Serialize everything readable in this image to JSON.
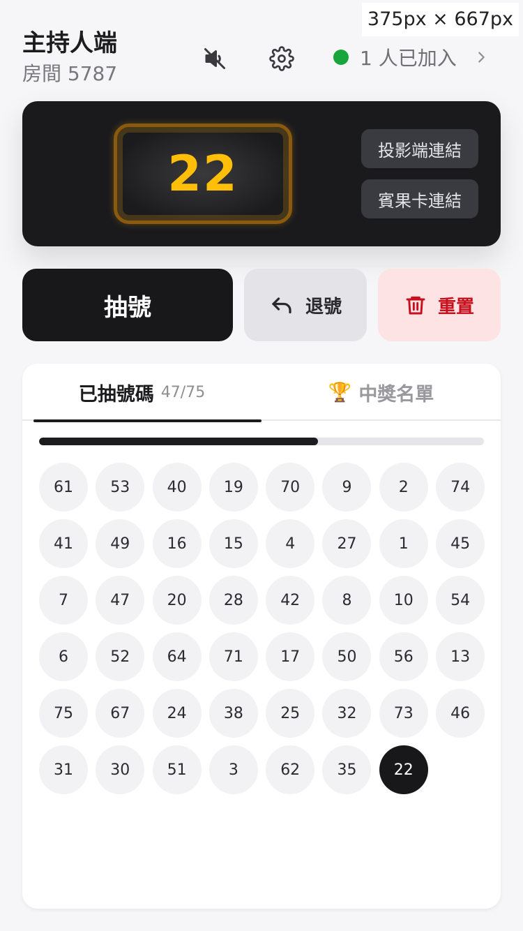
{
  "viewport_badge": "375px × 667px",
  "header": {
    "title": "主持人端",
    "room": "房間 5787",
    "players": "1 人已加入",
    "status_color": "#18a53b"
  },
  "stage": {
    "current_number": "22",
    "projector_link": "投影端連結",
    "bingo_card_link": "賓果卡連結"
  },
  "actions": {
    "draw": "抽號",
    "undo": "退號",
    "reset": "重置"
  },
  "tabs": {
    "drawn": "已抽號碼",
    "drawn_count": "47/75",
    "winners_icon": "🏆",
    "winners": "中獎名單"
  },
  "progress": {
    "drawn": 47,
    "total": 75
  },
  "drawn_numbers": [
    61,
    53,
    40,
    19,
    70,
    9,
    2,
    74,
    41,
    49,
    16,
    15,
    4,
    27,
    1,
    45,
    7,
    47,
    20,
    28,
    42,
    8,
    10,
    54,
    6,
    52,
    64,
    71,
    17,
    50,
    56,
    13,
    75,
    67,
    24,
    38,
    25,
    32,
    73,
    46,
    31,
    30,
    51,
    3,
    62,
    35,
    22
  ],
  "latest_number": 22
}
